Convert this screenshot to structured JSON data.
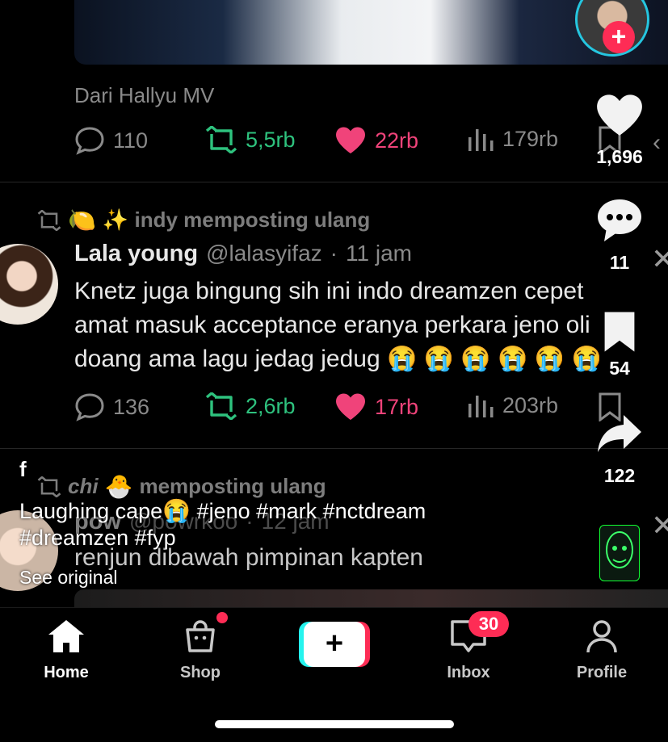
{
  "post1": {
    "source": "Dari Hallyu MV",
    "replies": "110",
    "reposts": "5,5rb",
    "likes": "22rb",
    "views": "179rb"
  },
  "post2": {
    "repost_by": "✨ indy memposting ulang",
    "name": "Lala young",
    "handle": "@lalasyifaz",
    "time": "11 jam",
    "text_line1": "Knetz juga bingung sih ini indo dreamzen cepet",
    "text_line2": "amat masuk acceptance eranya perkara jeno oli",
    "text_line3": "doang ama lagu jedag jedug",
    "replies": "136",
    "reposts": "2,6rb",
    "likes": "17rb",
    "views": "203rb"
  },
  "post3": {
    "repost_by_name": "chi",
    "repost_suffix": "memposting ulang",
    "name": "pow",
    "handle": "@powrkoo",
    "time": "12 jam",
    "text_line1": "renjun dibawah pimpinan kapten"
  },
  "sidebar": {
    "like_count": "1,696",
    "comment_count": "11",
    "save_count": "54",
    "share_count": "122"
  },
  "caption": {
    "author_initial": "f",
    "line1": "Laughing cape",
    "line1_tags": "#jeno #mark #nctdream",
    "line2": "#dreamzen #fyp",
    "see_original": "See original"
  },
  "navbar": {
    "home": "Home",
    "shop": "Shop",
    "inbox": "Inbox",
    "inbox_badge": "30",
    "profile": "Profile"
  },
  "colors": {
    "accent_pink": "#f0437a",
    "accent_green": "#2ec27e",
    "tiktok_red": "#fe2c55",
    "tiktok_cyan": "#25f4ee"
  }
}
